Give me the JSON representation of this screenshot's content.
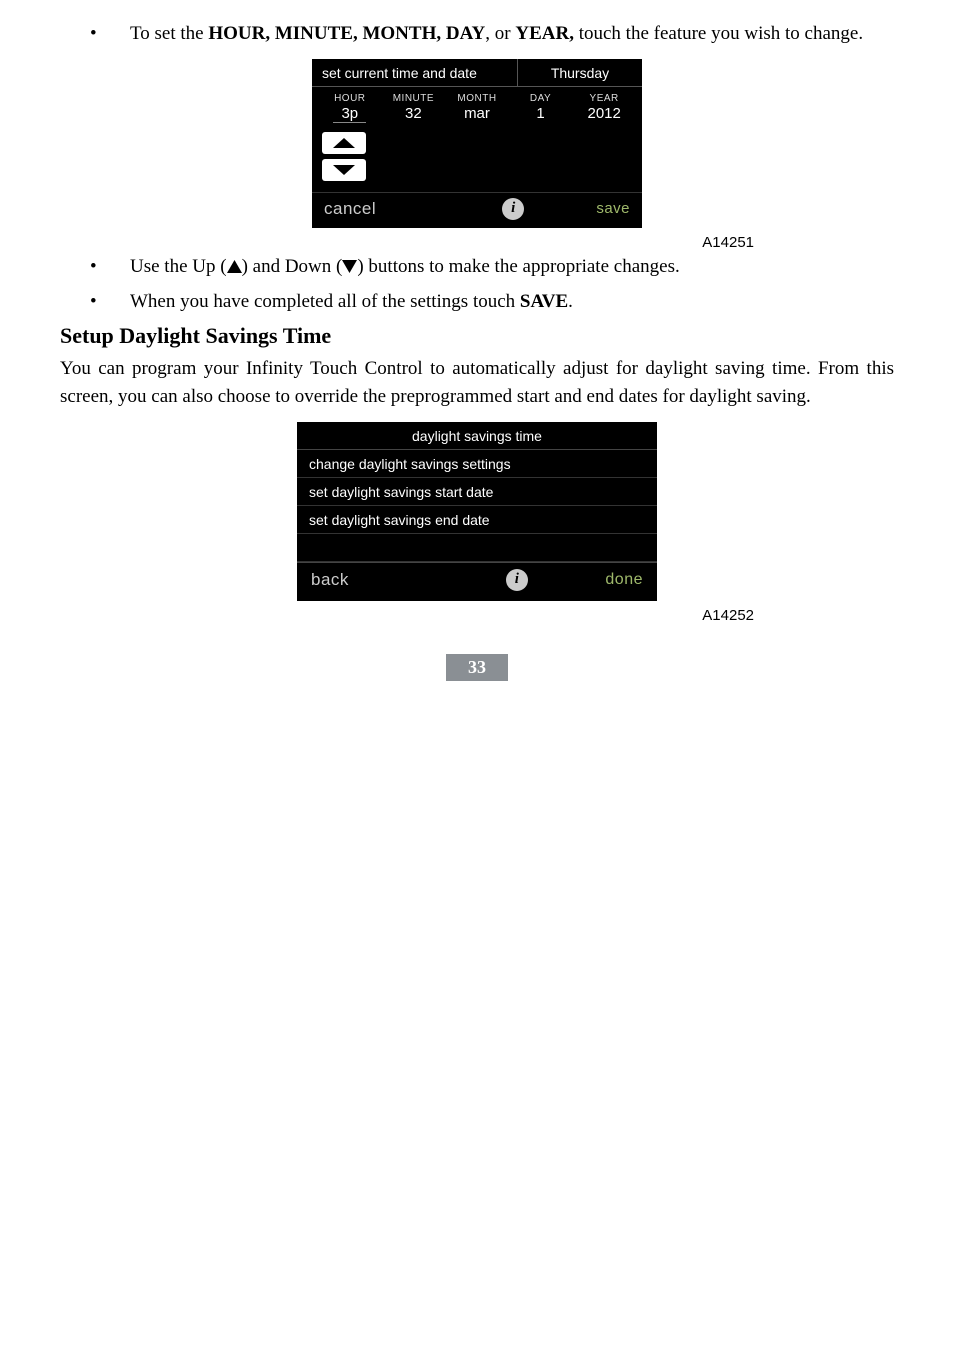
{
  "bullets": {
    "b1_pre": "To set the ",
    "b1_bold": "HOUR, MINUTE, MONTH, DAY",
    "b1_mid": ", or ",
    "b1_bold2": "YEAR,",
    "b1_post": " touch the feature you wish to change.",
    "b2_pre": "Use the Up (",
    "b2_mid": ") and Down (",
    "b2_post": ") buttons to make the appropriate changes.",
    "b3_pre": "When you have completed all of the settings touch ",
    "b3_bold": "SAVE",
    "b3_post": "."
  },
  "section_heading": "Setup Daylight Savings Time",
  "section_body": "You can program your Infinity Touch Control to automatically adjust for daylight saving time. From this screen, you can also choose to override the preprogrammed start and end dates for daylight saving.",
  "screen1": {
    "header_left": "set current time and date",
    "header_right": "Thursday",
    "cols": [
      {
        "label": "HOUR",
        "value": "3p"
      },
      {
        "label": "MINUTE",
        "value": "32"
      },
      {
        "label": "MONTH",
        "value": "mar"
      },
      {
        "label": "DAY",
        "value": "1"
      },
      {
        "label": "YEAR",
        "value": "2012"
      }
    ],
    "cancel": "cancel",
    "save": "save"
  },
  "caption1": "A14251",
  "screen2": {
    "title": "daylight savings time",
    "rows": [
      "change daylight savings settings",
      "set daylight savings start date",
      "set daylight savings end date"
    ],
    "back": "back",
    "done": "done"
  },
  "caption2": "A14252",
  "page_number": "33"
}
